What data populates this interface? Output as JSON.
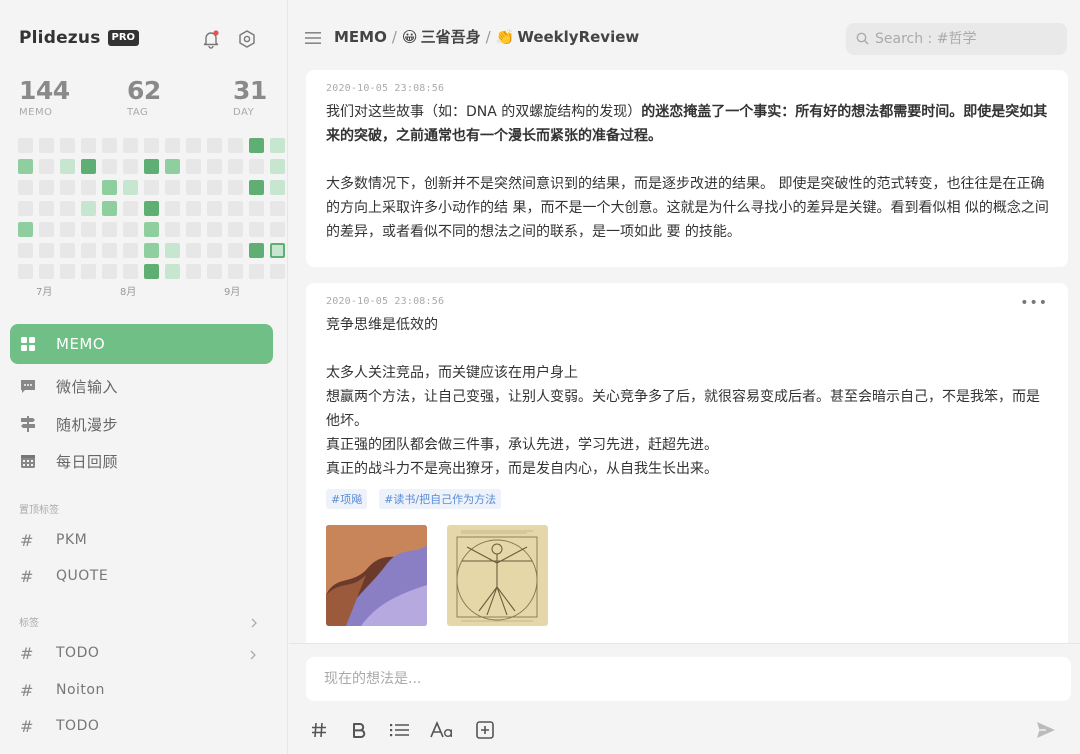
{
  "brand": {
    "name": "Plidezus",
    "badge": "PRO"
  },
  "icons": {
    "notification": "bell-icon",
    "settings": "hexagon-gear-icon",
    "menu": "hamburger-icon",
    "search": "search-icon",
    "send": "send-icon"
  },
  "stats": [
    {
      "value": "144",
      "label": "MEMO"
    },
    {
      "value": "62",
      "label": "TAG"
    },
    {
      "value": "31",
      "label": "DAY"
    }
  ],
  "heatmap": {
    "colors": {
      "empty": "#e7e7e7",
      "light": "#c6e6cf",
      "mid": "#8fcf9f",
      "dark": "#5fae73"
    },
    "months": [
      "7月",
      "8月",
      "9月"
    ],
    "grid": [
      [
        0,
        0,
        0,
        0,
        0,
        0,
        0,
        0,
        0,
        0,
        0,
        3,
        1
      ],
      [
        2,
        0,
        1,
        3,
        0,
        0,
        3,
        2,
        0,
        0,
        0,
        0,
        1
      ],
      [
        0,
        0,
        0,
        0,
        2,
        1,
        0,
        0,
        0,
        0,
        0,
        3,
        1
      ],
      [
        0,
        0,
        0,
        1,
        2,
        0,
        3,
        0,
        0,
        0,
        0,
        0,
        0
      ],
      [
        2,
        0,
        0,
        0,
        0,
        0,
        2,
        0,
        0,
        0,
        0,
        0,
        0
      ],
      [
        0,
        0,
        0,
        0,
        0,
        0,
        2,
        1,
        0,
        0,
        0,
        3,
        4
      ],
      [
        0,
        0,
        0,
        0,
        0,
        0,
        3,
        1,
        0,
        0,
        0,
        0,
        0
      ]
    ]
  },
  "nav": [
    {
      "label": "MEMO",
      "icon": "grid-icon",
      "active": true
    },
    {
      "label": "微信输入",
      "icon": "chat-icon",
      "active": false
    },
    {
      "label": "随机漫步",
      "icon": "signpost-icon",
      "active": false
    },
    {
      "label": "每日回顾",
      "icon": "calendar-icon",
      "active": false
    }
  ],
  "pinned_title": "置顶标签",
  "pinned_tags": [
    "PKM",
    "QUOTE"
  ],
  "tags_title": "标签",
  "tags": [
    {
      "label": "TODO",
      "has_children": true
    },
    {
      "label": "Noiton",
      "has_children": false
    },
    {
      "label": "TODO",
      "has_children": false
    }
  ],
  "breadcrumb": [
    {
      "emoji": "",
      "label": "MEMO"
    },
    {
      "emoji": "😀",
      "label": "三省吾身"
    },
    {
      "emoji": "👏",
      "label": "WeeklyReview"
    }
  ],
  "search": {
    "placeholder": "Search : #哲学"
  },
  "memos": [
    {
      "time": "2020-10-05 23:08:56",
      "paragraphs": [
        {
          "normal": "我们对这些故事（如：DNA 的双螺旋结构的发现）",
          "bold": "的迷恋掩盖了一个事实：所有好的想法都需要时间。即使是突如其来的突破，之前通常也有一个漫长而紧张的准备过程。"
        },
        {
          "normal": "",
          "bold": ""
        },
        {
          "normal": "大多数情况下，创新并不是突然间意识到的结果，而是逐步改进的结果。 即使是突破性的范式转变，也往往是在正确的方向上采取许多小动作的结 果，而不是一个大创意。这就是为什么寻找小的差异是关键。看到看似相 似的概念之间的差异，或者看似不同的想法之间的联系，是一项如此   要 的技能。",
          "bold": ""
        }
      ]
    },
    {
      "time": "2020-10-05 23:08:56",
      "more": "•••",
      "lines": [
        "竞争思维是低效的",
        "",
        "太多人关注竞品，而关键应该在用户身上",
        "想赢两个方法，让自己变强，让别人变弱。关心竞争多了后，就很容易变成后者。甚至会暗示自己，不是我笨，而是他坏。",
        "真正强的团队都会做三件事，承认先进，学习先进，赶超先进。",
        "真正的战斗力不是亮出獠牙，而是发自内心，从自我生长出来。"
      ],
      "tags": [
        "#项飚",
        "#读书/把自己作为方法"
      ],
      "images": [
        "canyon-photo",
        "vitruvian-man-drawing"
      ]
    }
  ],
  "editor": {
    "placeholder": "现在的想法是...",
    "tools": [
      "hash-icon",
      "bold-icon",
      "list-icon",
      "font-size-icon",
      "add-box-icon"
    ]
  }
}
